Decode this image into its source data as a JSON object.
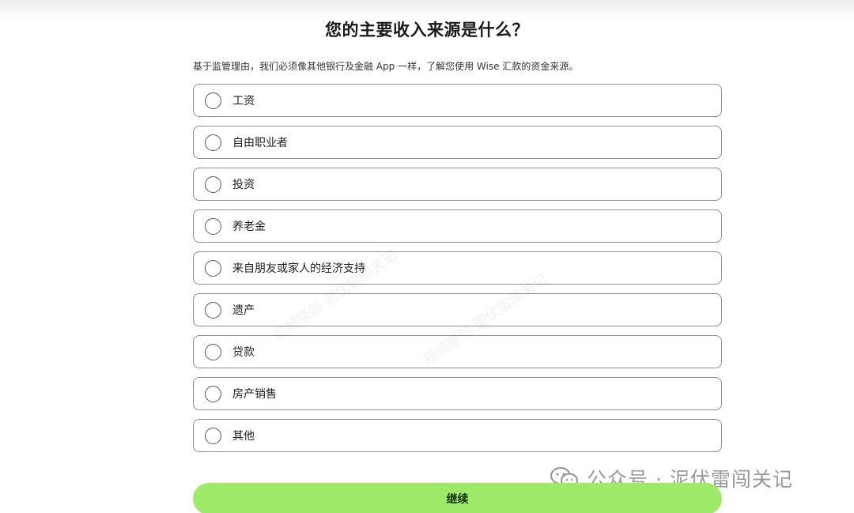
{
  "header": {
    "title": "您的主要收入来源是什么？",
    "subtitle": "基于监管理由，我们必须像其他银行及金融 App 一样，了解您使用 Wise 汇款的资金来源。"
  },
  "options": [
    {
      "label": "工资"
    },
    {
      "label": "自由职业者"
    },
    {
      "label": "投资"
    },
    {
      "label": "养老金"
    },
    {
      "label": "来自朋友或家人的经济支持"
    },
    {
      "label": "遗产"
    },
    {
      "label": "贷款"
    },
    {
      "label": "房产销售"
    },
    {
      "label": "其他"
    }
  ],
  "footer": {
    "continue_label": "继续"
  },
  "watermark": {
    "text": "公众号 · 泥伏雷闯关记",
    "icon": "wechat-icon",
    "diagonal_1": "视频原创 泥伏雷闯关记",
    "diagonal_2": "视频原创 泥伏雷闯关记"
  },
  "colors": {
    "accent": "#9ee86a",
    "accent_text": "#163300",
    "border": "#8c8c8c"
  }
}
